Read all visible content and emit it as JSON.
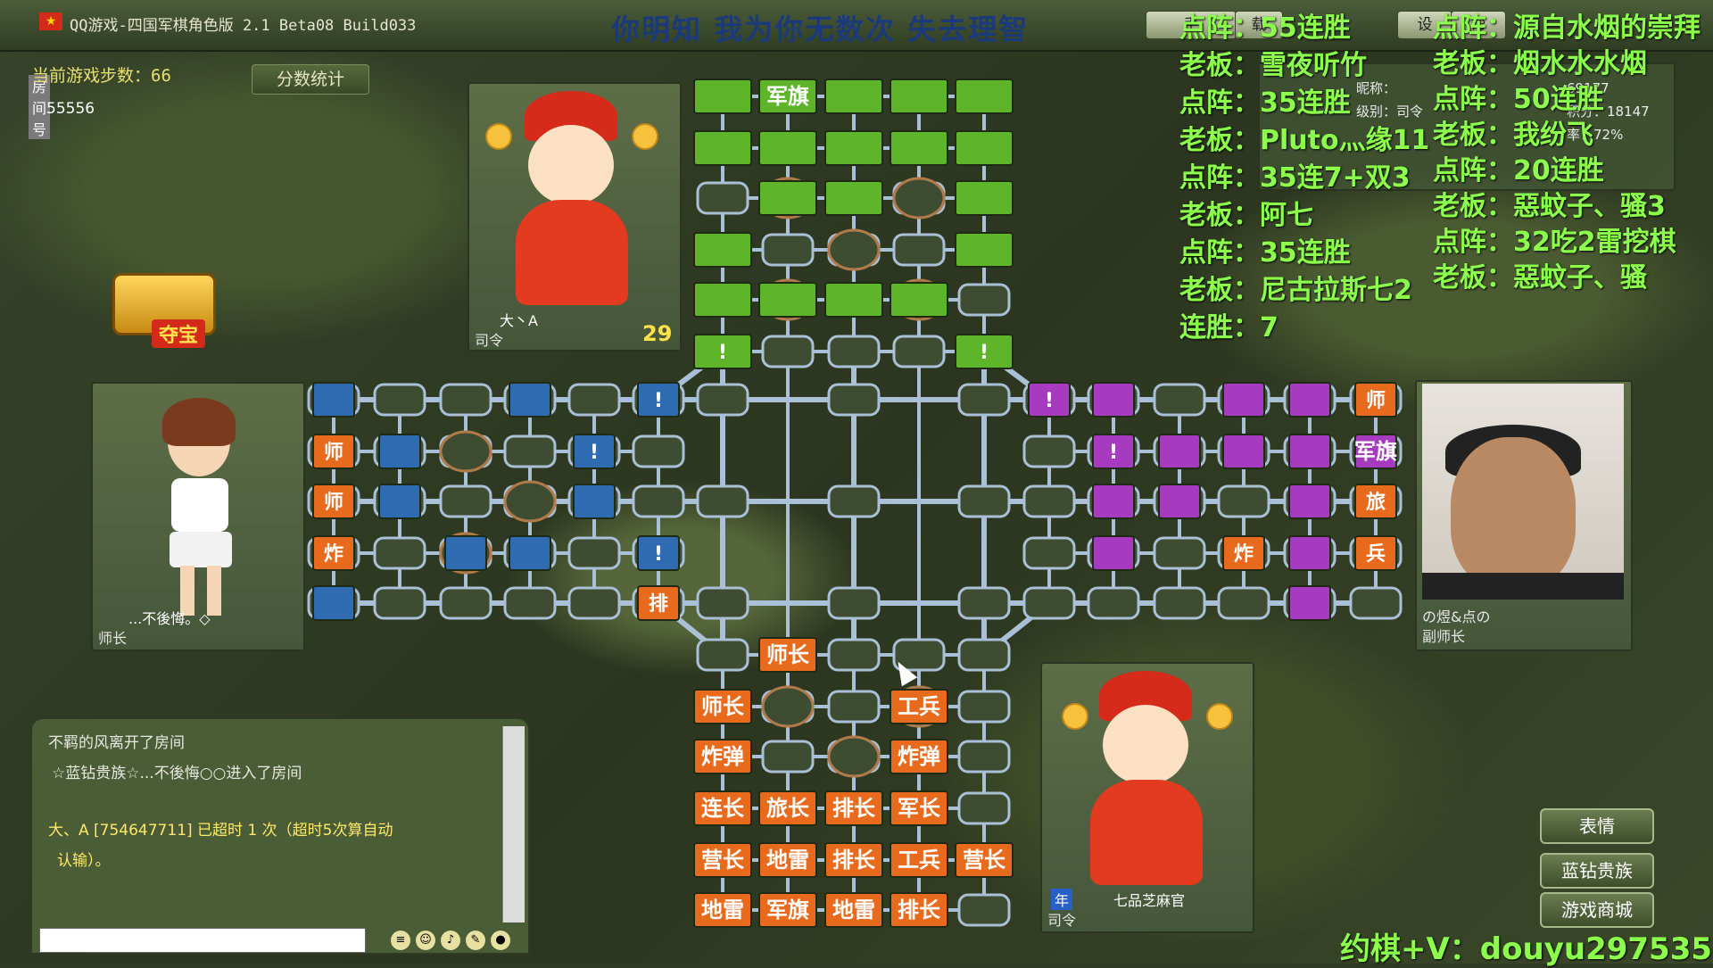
{
  "title_bar": {
    "app_title": "QQ游戏-四国军棋角色版 2.1 Beta08 Build033",
    "marquee": "你明知 我为你无数次 失去理智",
    "buttons": [
      "手",
      "载",
      "设",
      "帮"
    ]
  },
  "room": {
    "label": "房间号",
    "number": "55556"
  },
  "game_info": {
    "steps_text": "当前游戏步数：66",
    "score_button": "分数统计",
    "treasure_label": "夺宝"
  },
  "players": {
    "top": {
      "name": "大丶A",
      "rank": "司令",
      "timer": "29"
    },
    "left": {
      "name": "...不後悔。◇",
      "rank": "师长"
    },
    "right": {
      "name": "の煜&点の",
      "rank": "副师长"
    },
    "bottom": {
      "name": "七品芝麻官",
      "rank": "司令",
      "badge": "年"
    }
  },
  "player_stats": {
    "nickname_label": "昵称：",
    "level_label": "级别：司令",
    "nickname_value": "69177",
    "points_label": "积分：18147",
    "rate_label": "率：72%"
  },
  "overlay_left": [
    "点阵：55连胜",
    "老板：雪夜听竹",
    "点阵：35连胜",
    "老板：Pluto灬缘11",
    "点阵：35连7+双3",
    "老板：阿七",
    "点阵：35连胜",
    "老板：尼古拉斯七2",
    "连胜：7"
  ],
  "overlay_right": [
    "点阵：源自水烟的崇拜",
    "老板：烟水水水烟",
    "点阵：50连胜",
    "老板：我纷飞",
    "点阵：20连胜",
    "老板：惡蚊子、骚3",
    "点阵：32吃2雷挖棋",
    "老板：惡蚊子、骚"
  ],
  "board": {
    "top_labels": [
      "军旗"
    ],
    "bottom_pieces": [
      [
        "",
        "师长",
        "",
        "",
        ""
      ],
      [
        "师长",
        "",
        "",
        "工兵",
        ""
      ],
      [
        "炸弹",
        "",
        "",
        "炸弹",
        ""
      ],
      [
        "连长",
        "旅长",
        "排长",
        "军长",
        ""
      ],
      [
        "营长",
        "地雷",
        "排长",
        "工兵",
        "营长"
      ],
      [
        "地雷",
        "军旗",
        "地雷",
        "排长",
        ""
      ]
    ],
    "left_pieces": [
      "师",
      "师",
      "炸",
      "排"
    ],
    "right_pieces": [
      "师",
      "军旗",
      "旅",
      "兵",
      "炸"
    ],
    "colors": {
      "green": "#5fb52a",
      "blue": "#2f6bb0",
      "purple": "#a63bbf",
      "orange": "#e86a1c"
    }
  },
  "chat": {
    "lines": [
      "不羁的风离开了房间",
      "☆蓝钻贵族☆...不後悔○○进入了房间",
      "大、A [754647711] 已超时 1 次（超时5次算自动",
      "认输）。"
    ],
    "input_placeholder": ""
  },
  "side_buttons": [
    "表情",
    "蓝钻贵族",
    "游戏商城"
  ],
  "wechat": "约棋+V：douyu297535"
}
